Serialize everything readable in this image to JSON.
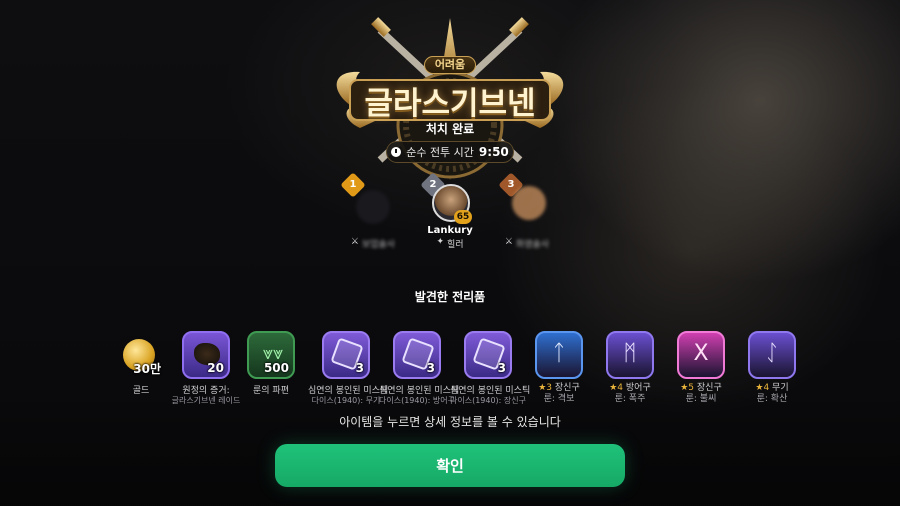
{
  "raid": {
    "difficulty": "어려움",
    "boss_name": "글라스기브넨",
    "status": "처치 완료",
    "battle_time_label": "순수 전투 시간",
    "battle_time_value": "9:50"
  },
  "party": [
    {
      "rank": "1",
      "name": "",
      "class": "보업술사",
      "level": ""
    },
    {
      "rank": "2",
      "name": "Lankury",
      "class": "힐러",
      "level": "65"
    },
    {
      "rank": "3",
      "name": "",
      "class": "화염술사",
      "level": ""
    }
  ],
  "loot": {
    "title": "발견한 전리품",
    "items": [
      {
        "qty": "30만",
        "label": "골드",
        "sub": "",
        "icon": "gold-coin-icon"
      },
      {
        "qty": "20",
        "label": "원정의 증거:",
        "sub": "글라스기브넨 레이드",
        "icon": "raid-proof-icon"
      },
      {
        "qty": "500",
        "label": "룬의 파편",
        "sub": "",
        "icon": "rune-fragment-icon"
      },
      {
        "qty": "3",
        "label": "심연의 봉인된 미스틱",
        "sub": "다이스(1940): 무기",
        "icon": "mystic-dice-icon"
      },
      {
        "qty": "3",
        "label": "심연의 봉인된 미스틱",
        "sub": "다이스(1940): 방어구",
        "icon": "mystic-dice-icon"
      },
      {
        "qty": "3",
        "label": "심연의 봉인된 미스틱",
        "sub": "다이스(1940): 장신구",
        "icon": "mystic-dice-icon"
      }
    ],
    "runes": [
      {
        "stars": "★3",
        "type": "장신구",
        "sub": "룬: 격보",
        "color": "#2f6fd0",
        "glyph": "ᛏ"
      },
      {
        "stars": "★4",
        "type": "방어구",
        "sub": "룬: 폭주",
        "color": "#6a4fd0",
        "glyph": "ᛗ"
      },
      {
        "stars": "★5",
        "type": "장신구",
        "sub": "룬: 불씨",
        "color": "#d03fb0",
        "glyph": "X"
      },
      {
        "stars": "★4",
        "type": "무기",
        "sub": "룬: 확산",
        "color": "#6a4fd0",
        "glyph": "ᛇ"
      }
    ]
  },
  "hint": "아이템을 누르면 상세 정보를 볼 수 있습니다",
  "confirm_label": "확인"
}
